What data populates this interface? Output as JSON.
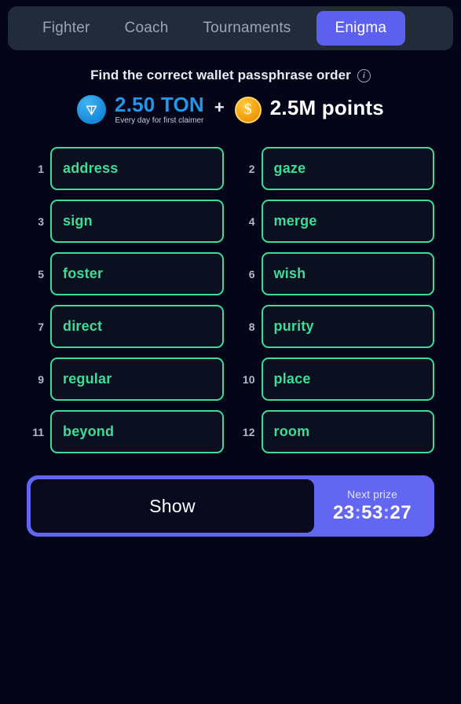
{
  "nav": {
    "tabs": [
      {
        "label": "Fighter",
        "active": false
      },
      {
        "label": "Coach",
        "active": false
      },
      {
        "label": "Tournaments",
        "active": false
      },
      {
        "label": "Enigma",
        "active": true
      }
    ]
  },
  "header": {
    "title": "Find the correct wallet passphrase order",
    "info_icon": "info-icon"
  },
  "prize": {
    "ton_icon": "ton-diamond-icon",
    "ton_amount": "2.50 TON",
    "ton_note": "Every day for first claimer",
    "plus": "+",
    "coin_icon": "dollar-coin-icon",
    "points_amount": "2.5M points"
  },
  "words": [
    {
      "num": "1",
      "word": "address"
    },
    {
      "num": "2",
      "word": "gaze"
    },
    {
      "num": "3",
      "word": "sign"
    },
    {
      "num": "4",
      "word": "merge"
    },
    {
      "num": "5",
      "word": "foster"
    },
    {
      "num": "6",
      "word": "wish"
    },
    {
      "num": "7",
      "word": "direct"
    },
    {
      "num": "8",
      "word": "purity"
    },
    {
      "num": "9",
      "word": "regular"
    },
    {
      "num": "10",
      "word": "place"
    },
    {
      "num": "11",
      "word": "beyond"
    },
    {
      "num": "12",
      "word": "room"
    }
  ],
  "actions": {
    "show_label": "Show",
    "next_prize_label": "Next prize",
    "timer_hours": "23",
    "timer_minutes": "53",
    "timer_seconds": "27",
    "timer_separator": ":"
  },
  "colors": {
    "background": "#05051a",
    "navbar": "#212b3a",
    "accent_purple": "#6366f1",
    "word_green": "#3ddc97",
    "ton_blue": "#2496e8",
    "coin_gold": "#f3a312"
  }
}
